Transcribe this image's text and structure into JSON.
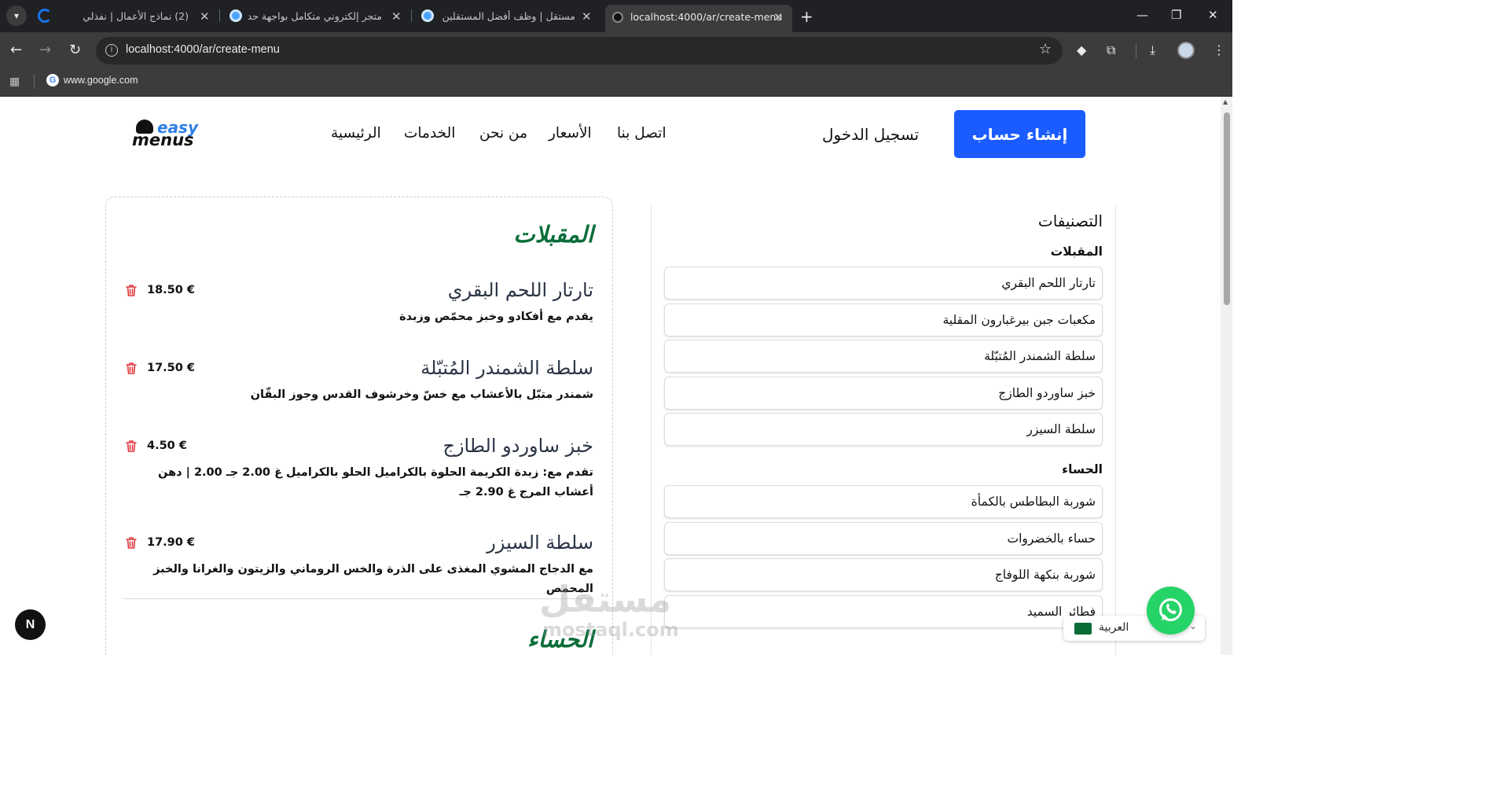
{
  "browser": {
    "tabs": [
      {
        "title": "(2) نماذج الأعمال | نفذلي",
        "active": false
      },
      {
        "title": "متجر إلكتروني متكامل بواجهة حديثة",
        "active": false
      },
      {
        "title": "مستقل | وظف أفضل المستقلين",
        "active": false
      },
      {
        "title": "localhost:4000/ar/create-menu",
        "active": true
      }
    ],
    "url": "localhost:4000/ar/create-menu",
    "bookmark": "www.google.com"
  },
  "site": {
    "logo_top": "easy",
    "logo_bottom": "menus",
    "nav": [
      "الرئيسية",
      "الخدمات",
      "من نحن",
      "الأسعار",
      "اتصل بنا"
    ],
    "login": "تسجيل الدخول",
    "signup": "إنشاء حساب"
  },
  "menu_preview": {
    "section1_title": "المقبلات",
    "items": [
      {
        "name": "تارتار اللحم البقري",
        "desc": "يقدم مع أفكادو وخبز محمّص وزبدة",
        "price": "18.50 €"
      },
      {
        "name": "سلطة الشمندر المُتبّلة",
        "desc": "شمندر متبّل بالأعشاب مع خسّ وخرشوف القدس وجوز البقّان",
        "price": "17.50 €"
      },
      {
        "name": "خبز ساوردو الطازج",
        "desc": "تقدم مع: زبدة الكريمة الحلوة بالكراميل الحلو بالكراميل غ 2.00 جـ 2.00 | دهن أعشاب المرج غ 2.90 جـ",
        "price": "4.50 €"
      },
      {
        "name": "سلطة السيزر",
        "desc": "مع الدجاج المشوي المغذى على الذرة والخس الروماني والزيتون والغرانا والخبز المحمص",
        "price": "17.90 €"
      }
    ],
    "section2_title": "الحساء"
  },
  "categories": {
    "heading": "التصنيفات",
    "groups": [
      {
        "title": "المقبلات",
        "items": [
          "تارتار اللحم البقري",
          "مكعبات جبن بيرغبارون المقلية",
          "سلطة الشمندر المُتبّلة",
          "خبز ساوردو الطازج",
          "سلطة السيزر"
        ]
      },
      {
        "title": "الحساء",
        "items": [
          "شوربة البطاطس بالكمأة",
          "حساء بالخضروات",
          "شوربة بنكهة اللوفاج",
          "فطائر السميد"
        ]
      }
    ]
  },
  "language": {
    "label": "العربية"
  },
  "watermark": {
    "ar": "مستقل",
    "en": "mostaql.com"
  },
  "dev_badge": "N",
  "colors": {
    "accent_blue": "#1a5cff",
    "section_green": "#0b6e3a",
    "delete_red": "#e0393e",
    "whatsapp": "#25d366"
  }
}
